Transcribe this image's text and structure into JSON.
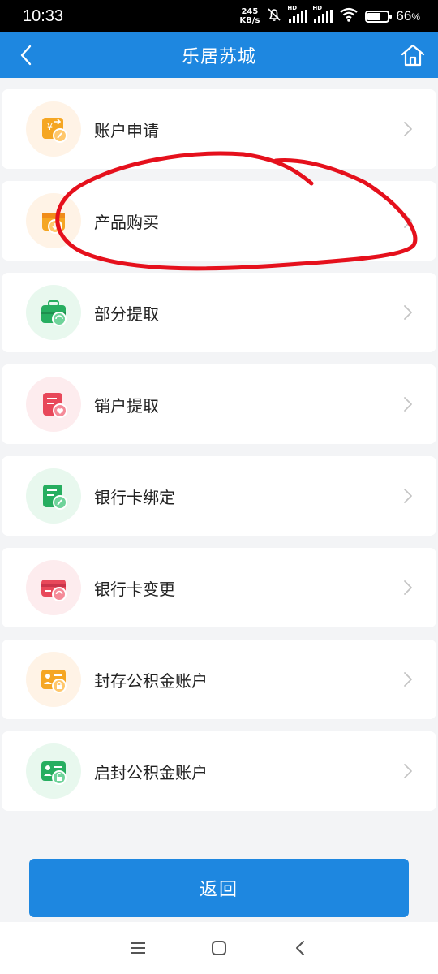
{
  "status_bar": {
    "time": "10:33",
    "net_speed_value": "245",
    "net_speed_unit": "KB/s",
    "hd_label": "HD",
    "battery_percent": "66",
    "battery_unit": "%"
  },
  "header": {
    "title": "乐居苏城",
    "color": "#1e87e0"
  },
  "menu": {
    "items": [
      {
        "label": "账户申请",
        "icon": "account-apply-icon",
        "tint": "#fff3e6"
      },
      {
        "label": "产品购买",
        "icon": "product-purchase-icon",
        "tint": "#fff3e6"
      },
      {
        "label": "部分提取",
        "icon": "partial-withdraw-icon",
        "tint": "#e8f8ee"
      },
      {
        "label": "销户提取",
        "icon": "close-account-withdraw-icon",
        "tint": "#fdecee"
      },
      {
        "label": "银行卡绑定",
        "icon": "bank-card-bind-icon",
        "tint": "#e8f8ee"
      },
      {
        "label": "银行卡变更",
        "icon": "bank-card-change-icon",
        "tint": "#fdecee"
      },
      {
        "label": "封存公积金账户",
        "icon": "seal-fund-account-icon",
        "tint": "#fff3e6"
      },
      {
        "label": "启封公积金账户",
        "icon": "unseal-fund-account-icon",
        "tint": "#e8f8ee"
      }
    ]
  },
  "footer": {
    "return_label": "返回"
  },
  "annotation": {
    "color": "#e5101c",
    "target": "产品购买"
  }
}
